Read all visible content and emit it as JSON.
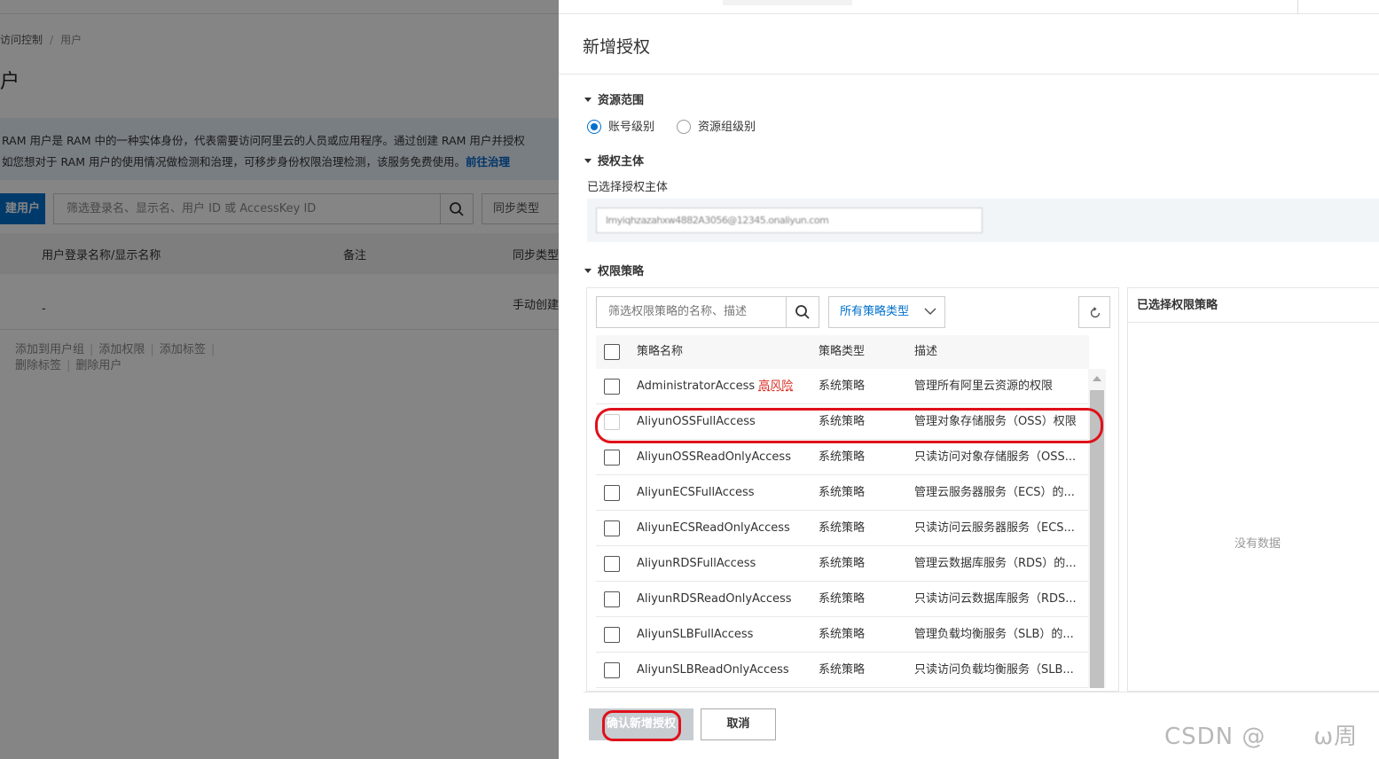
{
  "breadcrumb": {
    "parent": "访问控制",
    "current": "用户"
  },
  "page_title": "户",
  "info_banner": {
    "line1": "RAM 用户是 RAM 中的一种实体身份，代表需要访问阿里云的人员或应用程序。通过创建 RAM 用户并授权",
    "line2": "如您想对于 RAM 用户的使用情况做检测和治理，可移步身份权限治理检测，该服务免费使用。",
    "link": "前往治理"
  },
  "toolbar": {
    "create_label": "建用户",
    "search_placeholder": "筛选登录名、显示名、用户 ID 或 AccessKey ID",
    "sync_label": "同步类型"
  },
  "bg_table": {
    "columns": [
      "用户登录名称/显示名称",
      "备注",
      "同步类型"
    ],
    "row": {
      "name": "-",
      "sync": "手动创建"
    }
  },
  "bg_actions": {
    "row1": [
      "添加到用户组",
      "添加权限",
      "添加标签"
    ],
    "row2": [
      "删除标签",
      "删除用户"
    ]
  },
  "drawer": {
    "title": "新增授权",
    "sections": {
      "scope": "资源范围",
      "principal": "授权主体",
      "policy": "权限策略"
    },
    "scope_options": [
      {
        "label": "账号级别",
        "selected": true
      },
      {
        "label": "资源组级别",
        "selected": false
      }
    ],
    "principal_label": "已选择授权主体",
    "principal_value": "lmyiqhzazahxw4882A3056@12345.onaliyun.com",
    "filter_placeholder": "筛选权限策略的名称、描述",
    "type_select": "所有策略类型",
    "table_headers": {
      "name": "策略名称",
      "type": "策略类型",
      "desc": "描述"
    },
    "rows": [
      {
        "name": "AdministratorAccess",
        "badge": "高风险",
        "type": "系统策略",
        "desc": "管理所有阿里云资源的权限"
      },
      {
        "name": "AliyunOSSFullAccess",
        "badge": "",
        "type": "系统策略",
        "desc": "管理对象存储服务（OSS）权限"
      },
      {
        "name": "AliyunOSSReadOnlyAccess",
        "badge": "",
        "type": "系统策略",
        "desc": "只读访问对象存储服务（OSS..."
      },
      {
        "name": "AliyunECSFullAccess",
        "badge": "",
        "type": "系统策略",
        "desc": "管理云服务器服务（ECS）的..."
      },
      {
        "name": "AliyunECSReadOnlyAccess",
        "badge": "",
        "type": "系统策略",
        "desc": "只读访问云服务器服务（ECS..."
      },
      {
        "name": "AliyunRDSFullAccess",
        "badge": "",
        "type": "系统策略",
        "desc": "管理云数据库服务（RDS）的..."
      },
      {
        "name": "AliyunRDSReadOnlyAccess",
        "badge": "",
        "type": "系统策略",
        "desc": "只读访问云数据库服务（RDS..."
      },
      {
        "name": "AliyunSLBFullAccess",
        "badge": "",
        "type": "系统策略",
        "desc": "管理负载均衡服务（SLB）的..."
      },
      {
        "name": "AliyunSLBReadOnlyAccess",
        "badge": "",
        "type": "系统策略",
        "desc": "只读访问负载均衡服务（SLB..."
      }
    ],
    "selected_title": "已选择权限策略",
    "empty_text": "没有数据",
    "confirm_label": "确认新增授权",
    "cancel_label": "取消"
  },
  "watermark": "CSDN @　　ω周",
  "colors": {
    "accent": "#0070cc",
    "risk": "#d93026",
    "annotation": "#e0101a"
  }
}
